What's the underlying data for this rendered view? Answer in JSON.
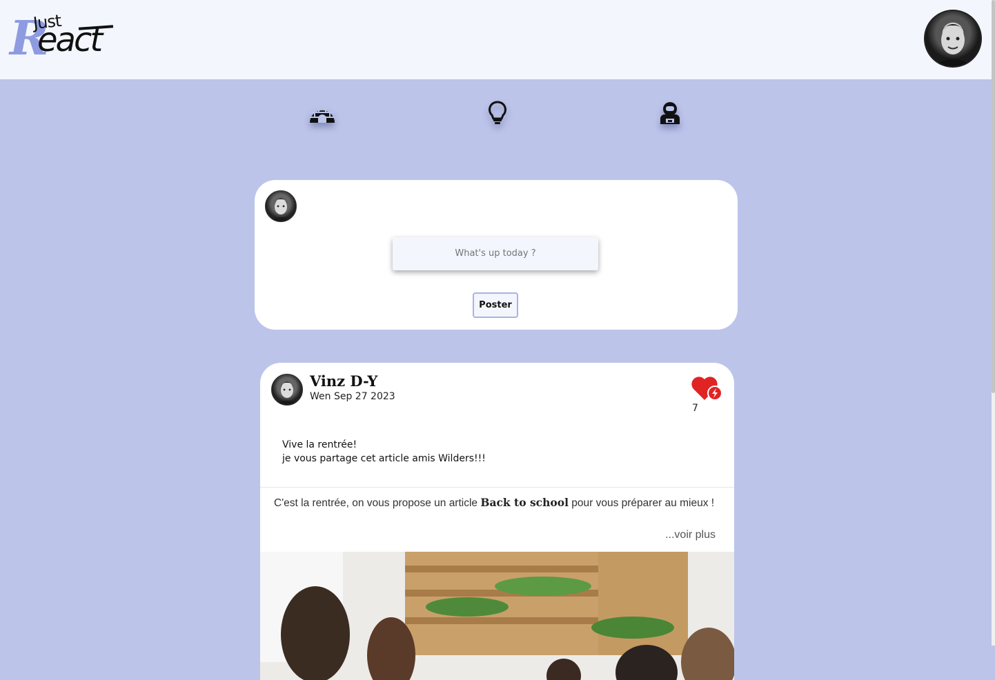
{
  "brand": {
    "logo_text_small": "Just",
    "logo_text_main": "React"
  },
  "nav": {
    "items": [
      {
        "name": "home",
        "icon": "igloo-icon"
      },
      {
        "name": "ideas",
        "icon": "lightbulb-icon"
      },
      {
        "name": "profile",
        "icon": "astronaut-icon"
      }
    ]
  },
  "composer": {
    "placeholder": "What's up today ?",
    "submit_label": "Poster"
  },
  "post": {
    "author": "Vinz D-Y",
    "date": "Wen Sep 27 2023",
    "likes": "7",
    "text_line1": "Vive la rentrée!",
    "text_line2": "je vous partage cet article amis Wilders!!!",
    "article": {
      "text_before": "C'est la rentrée, on vous propose un article ",
      "text_bold": "Back to school",
      "text_after": " pour vous préparer au mieux !",
      "more_label": "...voir plus"
    }
  },
  "colors": {
    "page_bg": "#bcc4ea",
    "topbar_bg": "#f3f6fd",
    "accent": "#8e9be0",
    "like_red": "#e02424"
  }
}
